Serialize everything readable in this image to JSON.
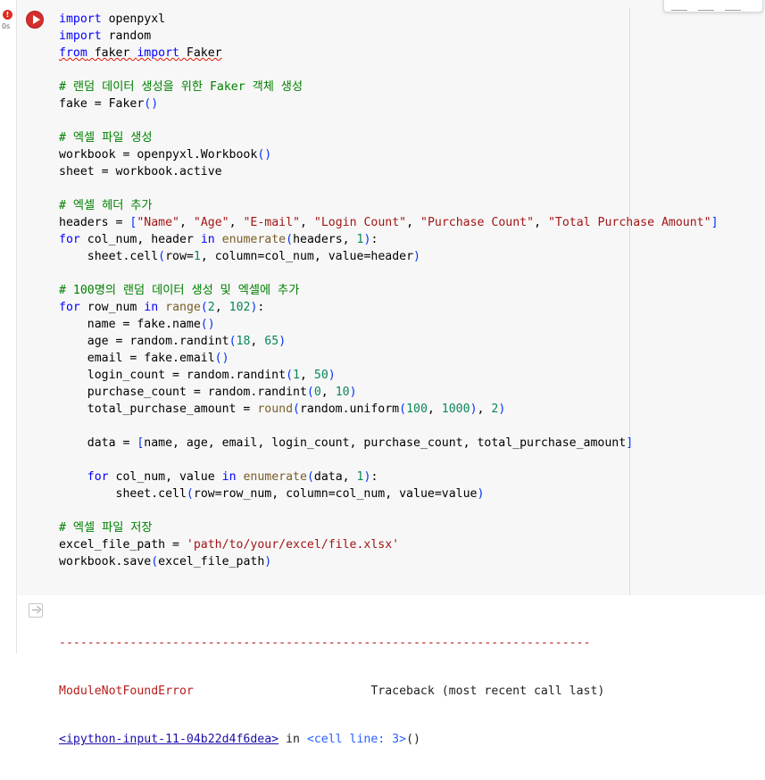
{
  "cell": {
    "status_icon": "error-exclamation-icon",
    "exec_time": "0s",
    "run_button_icon": "play-icon",
    "code_lines": [
      "import openpyxl",
      "import random",
      "from faker import Faker",
      "",
      "# 랜덤 데이터 생성을 위한 Faker 객체 생성",
      "fake = Faker()",
      "",
      "# 엑셀 파일 생성",
      "workbook = openpyxl.Workbook()",
      "sheet = workbook.active",
      "",
      "# 엑셀 헤더 추가",
      "headers = [\"Name\", \"Age\", \"E-mail\", \"Login Count\", \"Purchase Count\", \"Total Purchase Amount\"]",
      "for col_num, header in enumerate(headers, 1):",
      "    sheet.cell(row=1, column=col_num, value=header)",
      "",
      "# 100명의 랜덤 데이터 생성 및 엑셀에 추가",
      "for row_num in range(2, 102):",
      "    name = fake.name()",
      "    age = random.randint(18, 65)",
      "    email = fake.email()",
      "    login_count = random.randint(1, 50)",
      "    purchase_count = random.randint(0, 10)",
      "    total_purchase_amount = round(random.uniform(100, 1000), 2)",
      "",
      "    data = [name, age, email, login_count, purchase_count, total_purchase_amount]",
      "",
      "    for col_num, value in enumerate(data, 1):",
      "        sheet.cell(row=row_num, column=col_num, value=value)",
      "",
      "# 엑셀 파일 저장",
      "excel_file_path = 'path/to/your/excel/file.xlsx'",
      "workbook.save(excel_file_path)"
    ]
  },
  "output": {
    "icon": "output-redirect-icon",
    "separator": "---------------------------------------------------------------------------",
    "error_name": "ModuleNotFoundError",
    "traceback_label": "Traceback (most recent call last)",
    "input_ref": "<ipython-input-11-04b22d4f6dea>",
    "in_word": " in ",
    "cell_ref": "<cell line: 3>",
    "parens": "()"
  }
}
